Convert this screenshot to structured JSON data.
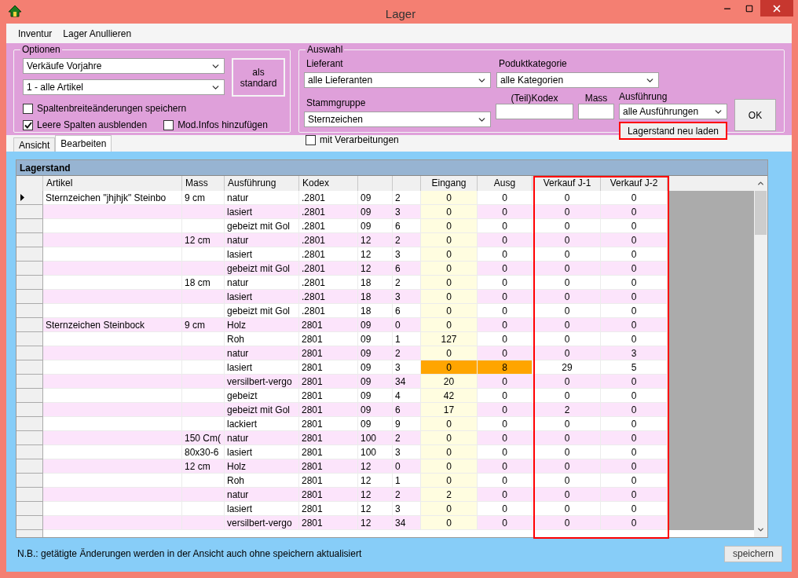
{
  "window": {
    "title": "Lager"
  },
  "menu": [
    "Inventur",
    "Lager Anullieren"
  ],
  "optionen": {
    "title": "Optionen",
    "selects": [
      "Verkäufe Vorjahre",
      "1 - alle Artikel"
    ],
    "default_button": "als standard",
    "checkboxes": [
      {
        "label": "Spaltenbreiteänderungen speichern",
        "checked": false
      },
      {
        "label": "Leere Spalten ausblenden",
        "checked": true
      },
      {
        "label": "Mod.Infos hinzufügen",
        "checked": false
      }
    ]
  },
  "auswahl": {
    "title": "Auswahl",
    "lieferant": {
      "label": "Lieferant",
      "value": "alle Lieferanten"
    },
    "kategorie": {
      "label": "Poduktkategorie",
      "value": "alle Kategorien"
    },
    "stammgruppe": {
      "label": "Stammgruppe",
      "value": "Sternzeichen"
    },
    "kodex": {
      "label": "(Teil)Kodex"
    },
    "mass": {
      "label": "Mass"
    },
    "ausfuehrung": {
      "label": "Ausführung",
      "value": "alle Ausführungen"
    },
    "verarbeitungen": {
      "label": "mit Verarbeitungen",
      "checked": false
    },
    "reload_button": {
      "label": "Lagerstand neu laden",
      "highlighted": true
    },
    "ok_button": "OK"
  },
  "tabs": [
    {
      "label": "Ansicht",
      "selected": false
    },
    {
      "label": "Bearbeiten",
      "selected": true
    }
  ],
  "table": {
    "title": "Lagerstand",
    "columns": [
      {
        "label": "Artikel",
        "highlighted": false
      },
      {
        "label": "Mass",
        "highlighted": false
      },
      {
        "label": "Ausführung",
        "highlighted": false
      },
      {
        "label": "Kodex",
        "highlighted": false
      },
      {
        "highlighted": false
      },
      {
        "highlighted": false
      },
      {
        "label": "Eingang",
        "highlighted": false
      },
      {
        "label": "Ausg",
        "highlighted": false
      },
      {
        "label": "Verkauf J-1",
        "highlighted": true
      },
      {
        "label": "Verkauf J-2",
        "highlighted": true
      }
    ],
    "rows": [
      {
        "current": true,
        "flagged": false,
        "artikel": "Sternzeichen \"jhjhjk\" Steinbo",
        "mass": "9 cm",
        "ausfuehrung": "natur",
        "kodex": ".2801",
        "column_5": "09",
        "column_6": "2",
        "eingang": "0",
        "ausgang": "0",
        "verkauf_j1": "0",
        "verkauf_j2": "0"
      },
      {
        "current": false,
        "flagged": false,
        "ausfuehrung": "lasiert",
        "kodex": ".2801",
        "column_5": "09",
        "column_6": "3",
        "eingang": "0",
        "ausgang": "0",
        "verkauf_j1": "0",
        "verkauf_j2": "0"
      },
      {
        "current": false,
        "flagged": false,
        "ausfuehrung": "gebeizt mit Gol",
        "kodex": ".2801",
        "column_5": "09",
        "column_6": "6",
        "eingang": "0",
        "ausgang": "0",
        "verkauf_j1": "0",
        "verkauf_j2": "0"
      },
      {
        "current": false,
        "flagged": false,
        "mass": "12 cm",
        "ausfuehrung": "natur",
        "kodex": ".2801",
        "column_5": "12",
        "column_6": "2",
        "eingang": "0",
        "ausgang": "0",
        "verkauf_j1": "0",
        "verkauf_j2": "0"
      },
      {
        "current": false,
        "flagged": false,
        "ausfuehrung": "lasiert",
        "kodex": ".2801",
        "column_5": "12",
        "column_6": "3",
        "eingang": "0",
        "ausgang": "0",
        "verkauf_j1": "0",
        "verkauf_j2": "0"
      },
      {
        "current": false,
        "flagged": false,
        "ausfuehrung": "gebeizt mit Gol",
        "kodex": ".2801",
        "column_5": "12",
        "column_6": "6",
        "eingang": "0",
        "ausgang": "0",
        "verkauf_j1": "0",
        "verkauf_j2": "0"
      },
      {
        "current": false,
        "flagged": false,
        "mass": "18 cm",
        "ausfuehrung": "natur",
        "kodex": ".2801",
        "column_5": "18",
        "column_6": "2",
        "eingang": "0",
        "ausgang": "0",
        "verkauf_j1": "0",
        "verkauf_j2": "0"
      },
      {
        "current": false,
        "flagged": false,
        "ausfuehrung": "lasiert",
        "kodex": ".2801",
        "column_5": "18",
        "column_6": "3",
        "eingang": "0",
        "ausgang": "0",
        "verkauf_j1": "0",
        "verkauf_j2": "0"
      },
      {
        "current": false,
        "flagged": false,
        "ausfuehrung": "gebeizt mit Gol",
        "kodex": ".2801",
        "column_5": "18",
        "column_6": "6",
        "eingang": "0",
        "ausgang": "0",
        "verkauf_j1": "0",
        "verkauf_j2": "0"
      },
      {
        "current": false,
        "flagged": false,
        "artikel": "Sternzeichen Steinbock",
        "mass": "9 cm",
        "ausfuehrung": "Holz",
        "kodex": "2801",
        "column_5": "09",
        "column_6": "0",
        "eingang": "0",
        "ausgang": "0",
        "verkauf_j1": "0",
        "verkauf_j2": "0"
      },
      {
        "current": false,
        "flagged": false,
        "ausfuehrung": "Roh",
        "kodex": "2801",
        "column_5": "09",
        "column_6": "1",
        "eingang": "127",
        "ausgang": "0",
        "verkauf_j1": "0",
        "verkauf_j2": "0"
      },
      {
        "current": false,
        "flagged": false,
        "ausfuehrung": "natur",
        "kodex": "2801",
        "column_5": "09",
        "column_6": "2",
        "eingang": "0",
        "ausgang": "0",
        "verkauf_j1": "0",
        "verkauf_j2": "3"
      },
      {
        "current": false,
        "flagged": true,
        "ausfuehrung": "lasiert",
        "kodex": "2801",
        "column_5": "09",
        "column_6": "3",
        "eingang": "0",
        "ausgang": "8",
        "verkauf_j1": "29",
        "verkauf_j2": "5"
      },
      {
        "current": false,
        "flagged": false,
        "ausfuehrung": "versilbert-vergo",
        "kodex": "2801",
        "column_5": "09",
        "column_6": "34",
        "eingang": "20",
        "ausgang": "0",
        "verkauf_j1": "0",
        "verkauf_j2": "0"
      },
      {
        "current": false,
        "flagged": false,
        "ausfuehrung": "gebeizt",
        "kodex": "2801",
        "column_5": "09",
        "column_6": "4",
        "eingang": "42",
        "ausgang": "0",
        "verkauf_j1": "0",
        "verkauf_j2": "0"
      },
      {
        "current": false,
        "flagged": false,
        "ausfuehrung": "gebeizt mit Gol",
        "kodex": "2801",
        "column_5": "09",
        "column_6": "6",
        "eingang": "17",
        "ausgang": "0",
        "verkauf_j1": "2",
        "verkauf_j2": "0"
      },
      {
        "current": false,
        "flagged": false,
        "ausfuehrung": "lackiert",
        "kodex": "2801",
        "column_5": "09",
        "column_6": "9",
        "eingang": "0",
        "ausgang": "0",
        "verkauf_j1": "0",
        "verkauf_j2": "0"
      },
      {
        "current": false,
        "flagged": false,
        "mass": "150 Cm(",
        "ausfuehrung": "natur",
        "kodex": "2801",
        "column_5": "100",
        "column_6": "2",
        "eingang": "0",
        "ausgang": "0",
        "verkauf_j1": "0",
        "verkauf_j2": "0"
      },
      {
        "current": false,
        "flagged": false,
        "mass": "80x30-6",
        "ausfuehrung": "lasiert",
        "kodex": "2801",
        "column_5": "100",
        "column_6": "3",
        "eingang": "0",
        "ausgang": "0",
        "verkauf_j1": "0",
        "verkauf_j2": "0"
      },
      {
        "current": false,
        "flagged": false,
        "mass": "12 cm",
        "ausfuehrung": "Holz",
        "kodex": "2801",
        "column_5": "12",
        "column_6": "0",
        "eingang": "0",
        "ausgang": "0",
        "verkauf_j1": "0",
        "verkauf_j2": "0"
      },
      {
        "current": false,
        "flagged": false,
        "ausfuehrung": "Roh",
        "kodex": "2801",
        "column_5": "12",
        "column_6": "1",
        "eingang": "0",
        "ausgang": "0",
        "verkauf_j1": "0",
        "verkauf_j2": "0"
      },
      {
        "current": false,
        "flagged": false,
        "ausfuehrung": "natur",
        "kodex": "2801",
        "column_5": "12",
        "column_6": "2",
        "eingang": "2",
        "ausgang": "0",
        "verkauf_j1": "0",
        "verkauf_j2": "0"
      },
      {
        "current": false,
        "flagged": false,
        "ausfuehrung": "lasiert",
        "kodex": "2801",
        "column_5": "12",
        "column_6": "3",
        "eingang": "0",
        "ausgang": "0",
        "verkauf_j1": "0",
        "verkauf_j2": "0"
      },
      {
        "current": false,
        "flagged": false,
        "ausfuehrung": "versilbert-vergo",
        "kodex": "2801",
        "column_5": "12",
        "column_6": "34",
        "eingang": "0",
        "ausgang": "0",
        "verkauf_j1": "0",
        "verkauf_j2": "0"
      }
    ]
  },
  "footer": {
    "note": "N.B.: getätigte Änderungen werden in der Ansicht auch ohne speichern aktualisiert",
    "save_button": "speichern"
  }
}
